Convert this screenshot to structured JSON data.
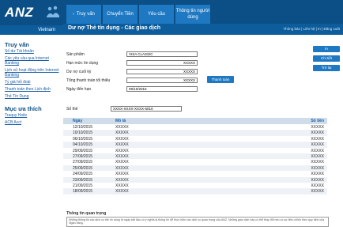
{
  "brand": {
    "logo_text": "ANZ",
    "language": "Vietnam"
  },
  "nav": {
    "tabs": [
      {
        "label": "Truy vấn"
      },
      {
        "label": "Chuyển Tiền"
      },
      {
        "label": "Yêu cầu"
      },
      {
        "label": "Thông tin người dùng"
      }
    ]
  },
  "header": {
    "page_title": "Dư nợ Thẻ tín dụng - Các giao dịch",
    "util_links": "Thông báo | Liên hệ | In | Đăng xuất"
  },
  "sidebar": {
    "section1_title": "Truy vấn",
    "section1_items": [
      "Số dư Tài khoản",
      "Các yêu cầu qua Internet Banking",
      "Lịch sử hoạt động trên Internet Banking",
      "Tỷ giá hối đoái",
      "Thanh toán theo Lịch định",
      "Thẻ Tín Dụng"
    ],
    "section2_title": "Mục ưa thích",
    "section2_items": [
      "Traquy Hoile",
      "ACB Acct"
    ]
  },
  "form": {
    "product_label": "Sản phẩm",
    "product_value": "VISA CLASSIC",
    "limit_label": "Hạn mức tín dụng",
    "limit_value": "XXXXX",
    "balance_label": "Dư nợ cuối kỳ",
    "balance_value": "XXXXX",
    "min_pay_label": "Tổng thanh toán tối thiểu",
    "min_pay_value": "XXXXX",
    "due_label": "Ngày đến hạn",
    "due_value": "09/10/2015",
    "pay_button": "Thanh toán",
    "card_label": "Số thẻ",
    "card_value": "XXXX-XXXX-XXXX-6010"
  },
  "right_buttons": {
    "print": "In",
    "detail": "Chi tiết",
    "back": "Trở lại"
  },
  "table": {
    "headers": {
      "date": "Ngày",
      "desc": "Mô tả",
      "amount": "Số tiền"
    },
    "rows": [
      {
        "date": "12/10/2015",
        "desc": "XXXXX",
        "amount": "XXXXX"
      },
      {
        "date": "10/10/2015",
        "desc": "XXXXX",
        "amount": "XXXXX"
      },
      {
        "date": "06/10/2015",
        "desc": "XXXXX",
        "amount": "XXXXX"
      },
      {
        "date": "04/10/2015",
        "desc": "XXXXX",
        "amount": "XXXXX"
      },
      {
        "date": "29/09/2015",
        "desc": "XXXXX",
        "amount": "XXXXX"
      },
      {
        "date": "27/09/2015",
        "desc": "XXXXX",
        "amount": "XXXXX"
      },
      {
        "date": "27/09/2015",
        "desc": "XXXXX",
        "amount": "XXXXX"
      },
      {
        "date": "25/09/2015",
        "desc": "XXXXX",
        "amount": "XXXXX"
      },
      {
        "date": "24/09/2015",
        "desc": "XXXXX",
        "amount": "XXXXX"
      },
      {
        "date": "23/09/2015",
        "desc": "XXXXX",
        "amount": "XXXXX"
      },
      {
        "date": "21/09/2015",
        "desc": "XXXXX",
        "amount": "XXXXX"
      },
      {
        "date": "18/09/2015",
        "desc": "XXXXX",
        "amount": "XXXXX"
      }
    ]
  },
  "notice": {
    "title": "Thông tin quan trọng",
    "text": "Những thông tin các dịch vụ thẻ tín dụng từ ngày bắt đầu có ý nghĩa là thông tin để thực hiện các dịch vụ quan trọng của ANZ. Những giao dịch này có thể thay đổi nếu có sự điều chỉnh theo quy định của Ngân hàng."
  },
  "colors": {
    "brand": "#0b4f86",
    "tab": "#1e78c2",
    "link": "#1b5ea6",
    "table_header": "#cfdcea"
  }
}
